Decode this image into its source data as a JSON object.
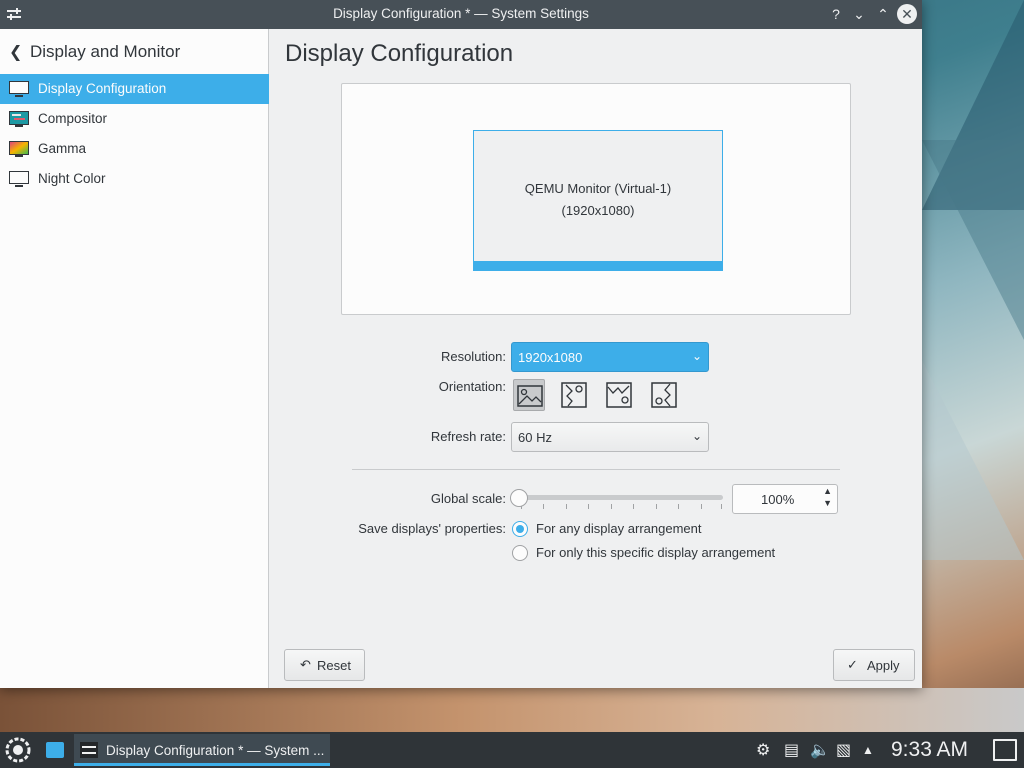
{
  "window": {
    "title": "Display Configuration * — System Settings",
    "help_glyph": "?",
    "minimize_glyph": "⌄",
    "maximize_glyph": "⌃",
    "close_glyph": "✕"
  },
  "sidebar": {
    "back_label": "Display and Monitor",
    "items": [
      {
        "label": "Display Configuration",
        "icon": "monitor-icon",
        "active": true
      },
      {
        "label": "Compositor",
        "icon": "compositor-icon",
        "active": false
      },
      {
        "label": "Gamma",
        "icon": "gamma-icon",
        "active": false
      },
      {
        "label": "Night Color",
        "icon": "night-color-icon",
        "active": false
      }
    ]
  },
  "main": {
    "page_title": "Display Configuration",
    "monitor": {
      "name": "QEMU Monitor (Virtual-1)",
      "resolution": "(1920x1080)"
    },
    "resolution_label": "Resolution:",
    "resolution_value": "1920x1080",
    "orientation_label": "Orientation:",
    "orientations": [
      "landscape",
      "rotate-left",
      "portrait-flipped",
      "rotate-right"
    ],
    "refresh_label": "Refresh rate:",
    "refresh_value": "60 Hz",
    "scale_label": "Global scale:",
    "scale_value": "100%",
    "scale_fraction": 0.0,
    "save_label": "Save displays' properties:",
    "save_options": [
      {
        "label": "For any display arrangement",
        "checked": true
      },
      {
        "label": "For only this specific display arrangement",
        "checked": false
      }
    ],
    "reset_label": "Reset",
    "apply_label": "Apply"
  },
  "taskbar": {
    "task_label": "Display Configuration * — System ...",
    "clock": "9:33 AM"
  },
  "colors": {
    "accent": "#3daee9",
    "titlebar": "#475057",
    "taskbar": "#2f3438"
  }
}
